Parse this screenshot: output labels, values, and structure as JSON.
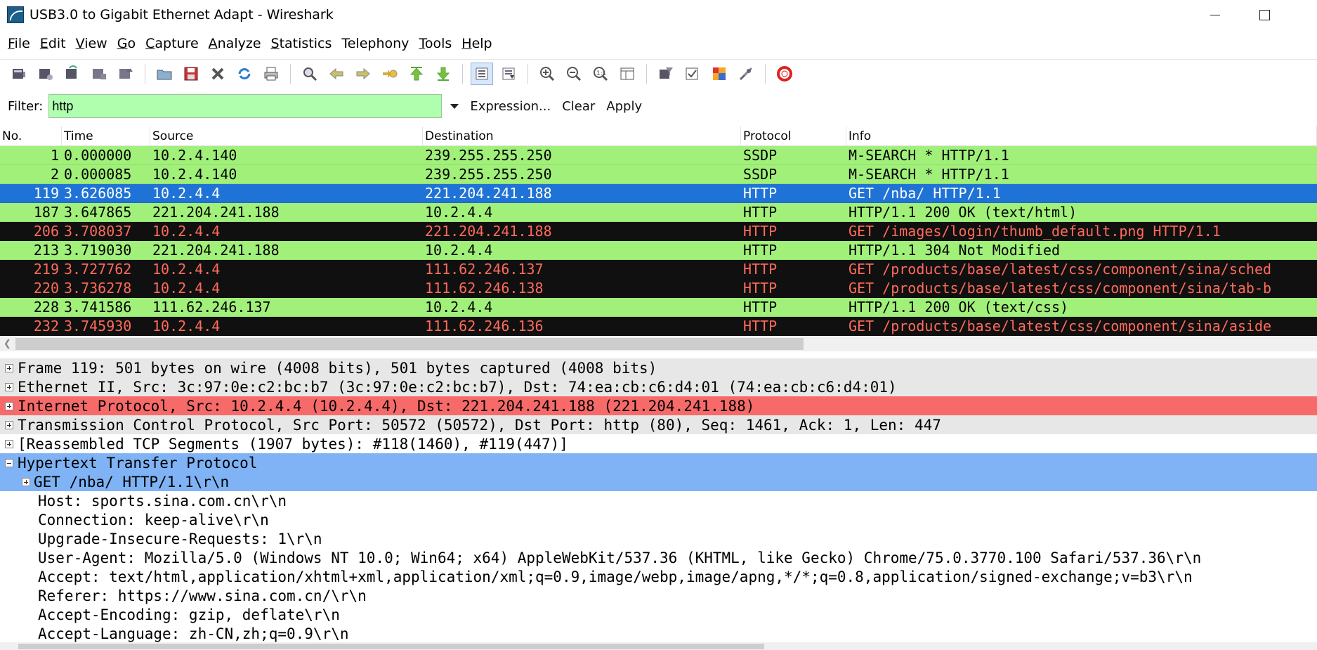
{
  "window": {
    "title": "USB3.0 to Gigabit Ethernet Adapt - Wireshark"
  },
  "menu": [
    {
      "label": "File",
      "key": "F",
      "rest": "ile"
    },
    {
      "label": "Edit",
      "key": "E",
      "rest": "dit"
    },
    {
      "label": "View",
      "key": "V",
      "rest": "iew"
    },
    {
      "label": "Go",
      "key": "G",
      "rest": "o"
    },
    {
      "label": "Capture",
      "key": "C",
      "rest": "apture"
    },
    {
      "label": "Analyze",
      "key": "A",
      "rest": "nalyze"
    },
    {
      "label": "Statistics",
      "key": "S",
      "rest": "tatistics"
    },
    {
      "label": "Telephony",
      "key": "",
      "rest": "Telephony"
    },
    {
      "label": "Tools",
      "key": "T",
      "rest": "ools"
    },
    {
      "label": "Help",
      "key": "H",
      "rest": "elp"
    }
  ],
  "filter": {
    "label": "Filter:",
    "value": "http",
    "expression_label": "Expression...",
    "clear_label": "Clear",
    "apply_label": "Apply"
  },
  "packet_list": {
    "columns": [
      "No.",
      "Time",
      "Source",
      "Destination",
      "Protocol",
      "Info"
    ],
    "rows": [
      {
        "no": "1",
        "time": "0.000000",
        "src": "10.2.4.140",
        "dst": "239.255.255.250",
        "proto": "SSDP",
        "info": "M-SEARCH * HTTP/1.1",
        "style": "green"
      },
      {
        "no": "2",
        "time": "0.000085",
        "src": "10.2.4.140",
        "dst": "239.255.255.250",
        "proto": "SSDP",
        "info": "M-SEARCH * HTTP/1.1",
        "style": "green"
      },
      {
        "no": "119",
        "time": "3.626085",
        "src": "10.2.4.4",
        "dst": "221.204.241.188",
        "proto": "HTTP",
        "info": "GET /nba/ HTTP/1.1",
        "style": "selected"
      },
      {
        "no": "187",
        "time": "3.647865",
        "src": "221.204.241.188",
        "dst": "10.2.4.4",
        "proto": "HTTP",
        "info": "HTTP/1.1 200 OK  (text/html)",
        "style": "green"
      },
      {
        "no": "206",
        "time": "3.708037",
        "src": "10.2.4.4",
        "dst": "221.204.241.188",
        "proto": "HTTP",
        "info": "GET /images/login/thumb_default.png HTTP/1.1",
        "style": "black"
      },
      {
        "no": "213",
        "time": "3.719030",
        "src": "221.204.241.188",
        "dst": "10.2.4.4",
        "proto": "HTTP",
        "info": "HTTP/1.1 304 Not Modified",
        "style": "green"
      },
      {
        "no": "219",
        "time": "3.727762",
        "src": "10.2.4.4",
        "dst": "111.62.246.137",
        "proto": "HTTP",
        "info": "GET /products/base/latest/css/component/sina/sched",
        "style": "black"
      },
      {
        "no": "220",
        "time": "3.736278",
        "src": "10.2.4.4",
        "dst": "111.62.246.138",
        "proto": "HTTP",
        "info": "GET /products/base/latest/css/component/sina/tab-b",
        "style": "black"
      },
      {
        "no": "228",
        "time": "3.741586",
        "src": "111.62.246.137",
        "dst": "10.2.4.4",
        "proto": "HTTP",
        "info": "HTTP/1.1 200 OK  (text/css)",
        "style": "green"
      },
      {
        "no": "232",
        "time": "3.745930",
        "src": "10.2.4.4",
        "dst": "111.62.246.136",
        "proto": "HTTP",
        "info": "GET /products/base/latest/css/component/sina/aside",
        "style": "black"
      }
    ]
  },
  "details": [
    {
      "text": "Frame 119: 501 bytes on wire (4008 bits), 501 bytes captured (4008 bits)",
      "level": 0,
      "expander": "plus",
      "style": "gray"
    },
    {
      "text": "Ethernet II, Src: 3c:97:0e:c2:bc:b7 (3c:97:0e:c2:bc:b7), Dst: 74:ea:cb:c6:d4:01 (74:ea:cb:c6:d4:01)",
      "level": 0,
      "expander": "plus",
      "style": "gray"
    },
    {
      "text": "Internet Protocol, Src: 10.2.4.4 (10.2.4.4), Dst: 221.204.241.188 (221.204.241.188)",
      "level": 0,
      "expander": "plus",
      "style": "red"
    },
    {
      "text": "Transmission Control Protocol, Src Port: 50572 (50572), Dst Port: http (80), Seq: 1461, Ack: 1, Len: 447",
      "level": 0,
      "expander": "plus",
      "style": "gray"
    },
    {
      "text": "[Reassembled TCP Segments (1907 bytes): #118(1460), #119(447)]",
      "level": 0,
      "expander": "plus",
      "style": "none"
    },
    {
      "text": "Hypertext Transfer Protocol",
      "level": 0,
      "expander": "minus",
      "style": "blue"
    },
    {
      "text": "GET /nba/ HTTP/1.1\\r\\n",
      "level": 1,
      "expander": "plus",
      "style": "blue"
    },
    {
      "text": "Host: sports.sina.com.cn\\r\\n",
      "level": 2,
      "expander": "none",
      "style": "none"
    },
    {
      "text": "Connection: keep-alive\\r\\n",
      "level": 2,
      "expander": "none",
      "style": "none"
    },
    {
      "text": "Upgrade-Insecure-Requests: 1\\r\\n",
      "level": 2,
      "expander": "none",
      "style": "none"
    },
    {
      "text": "User-Agent: Mozilla/5.0 (Windows NT 10.0; Win64; x64) AppleWebKit/537.36 (KHTML, like Gecko) Chrome/75.0.3770.100 Safari/537.36\\r\\n",
      "level": 2,
      "expander": "none",
      "style": "none"
    },
    {
      "text": "Accept: text/html,application/xhtml+xml,application/xml;q=0.9,image/webp,image/apng,*/*;q=0.8,application/signed-exchange;v=b3\\r\\n",
      "level": 2,
      "expander": "none",
      "style": "none"
    },
    {
      "text": "Referer: https://www.sina.com.cn/\\r\\n",
      "level": 2,
      "expander": "none",
      "style": "none"
    },
    {
      "text": "Accept-Encoding: gzip, deflate\\r\\n",
      "level": 2,
      "expander": "none",
      "style": "none"
    },
    {
      "text": "Accept-Language: zh-CN,zh;q=0.9\\r\\n",
      "level": 2,
      "expander": "none",
      "style": "none"
    }
  ],
  "toolbar": {
    "icons": [
      "interfaces-icon",
      "options-icon",
      "start-capture-icon",
      "stop-capture-icon",
      "restart-capture-icon",
      "sep",
      "open-file-icon",
      "save-file-icon",
      "close-file-icon",
      "reload-icon",
      "print-icon",
      "sep",
      "find-packet-icon",
      "go-back-icon",
      "go-forward-icon",
      "go-to-packet-icon",
      "go-first-icon",
      "go-last-icon",
      "sep",
      "colorize-icon",
      "autoscroll-icon",
      "sep",
      "zoom-in-icon",
      "zoom-out-icon",
      "zoom-normal-icon",
      "resize-columns-icon",
      "sep",
      "capture-filters-icon",
      "display-filters-icon",
      "coloring-rules-icon",
      "preferences-icon",
      "sep",
      "help-icon"
    ],
    "active": [
      "colorize-icon"
    ]
  },
  "colors": {
    "row_green": "#a0f07a",
    "row_selected": "#1f73d6",
    "row_black": "#101010",
    "row_black_text": "#ff6b5b",
    "filter_bg": "#afffaf",
    "detail_red": "#f76a6a",
    "detail_blue": "#7fb3f5",
    "detail_gray": "#e7e7e7"
  }
}
